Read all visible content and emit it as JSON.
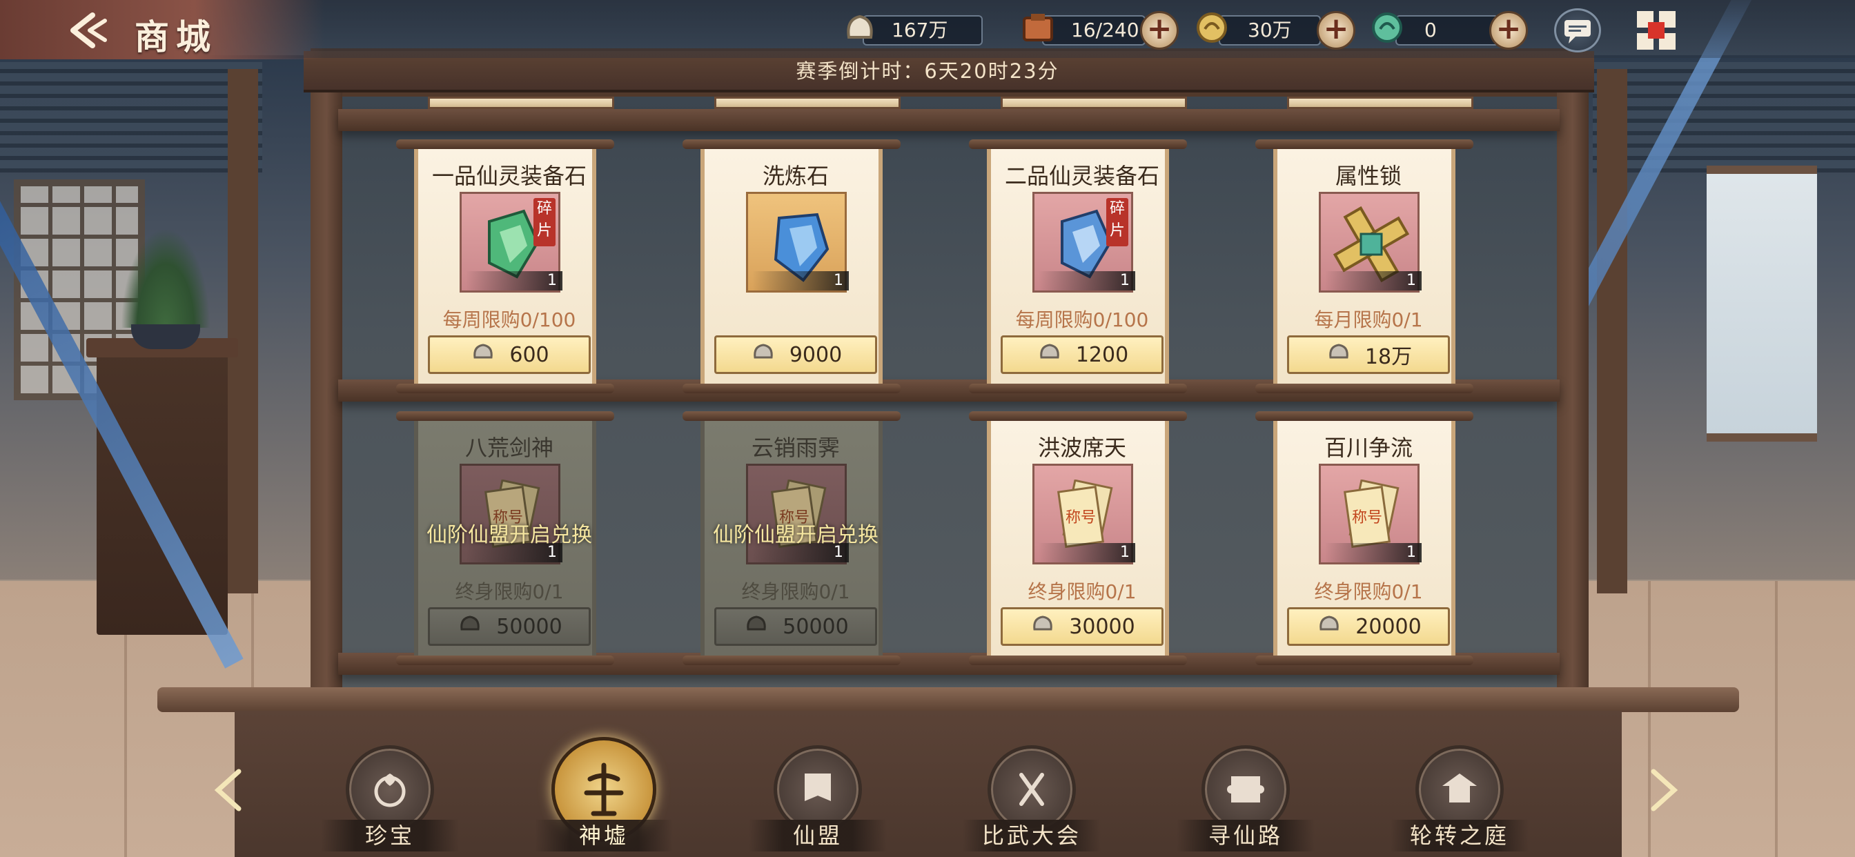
{
  "header": {
    "title": "商城",
    "countdown": "赛季倒计时：6天20时23分"
  },
  "currencies": [
    {
      "name": "silver-coin",
      "value": "167万",
      "color": "#d9b27a"
    },
    {
      "name": "bag",
      "value": "16/240",
      "color": "#c26a3c"
    },
    {
      "name": "gold-dragon",
      "value": "30万",
      "color": "#e2c063"
    },
    {
      "name": "jade-dragon",
      "value": "0",
      "color": "#5fbf9d"
    }
  ],
  "items_row1": [
    {
      "name": "一品仙灵装备石",
      "qty": "1",
      "fragment_tag": "碎片",
      "limit": "每周限购0/100",
      "price": "600",
      "icon": "green-crystal-fragment-icon"
    },
    {
      "name": "洗炼石",
      "qty": "1",
      "fragment_tag": "",
      "limit": "",
      "price": "9000",
      "icon": "blue-stone-icon"
    },
    {
      "name": "二品仙灵装备石",
      "qty": "1",
      "fragment_tag": "碎片",
      "limit": "每周限购0/100",
      "price": "1200",
      "icon": "blue-crystal-fragment-icon"
    },
    {
      "name": "属性锁",
      "qty": "1",
      "fragment_tag": "",
      "limit": "每月限购0/1",
      "price": "18万",
      "icon": "attribute-lock-icon"
    }
  ],
  "items_row2": [
    {
      "name": "八荒剑神",
      "qty": "1",
      "limit": "终身限购0/1",
      "price": "50000",
      "locked": true,
      "lock_text": "仙阶仙盟开启兑换",
      "ticket_text": "称号"
    },
    {
      "name": "云销雨霁",
      "qty": "1",
      "limit": "终身限购0/1",
      "price": "50000",
      "locked": true,
      "lock_text": "仙阶仙盟开启兑换",
      "ticket_text": "称号"
    },
    {
      "name": "洪波席天",
      "qty": "1",
      "limit": "终身限购0/1",
      "price": "30000",
      "locked": false,
      "ticket_text": "称号"
    },
    {
      "name": "百川争流",
      "qty": "1",
      "limit": "终身限购0/1",
      "price": "20000",
      "locked": false,
      "ticket_text": "称号"
    }
  ],
  "tabs": [
    {
      "label": "珍宝",
      "icon": "treasure-icon",
      "active": false
    },
    {
      "label": "神墟",
      "icon": "divine-ruins-icon",
      "active": true
    },
    {
      "label": "仙盟",
      "icon": "alliance-banner-icon",
      "active": false
    },
    {
      "label": "比武大会",
      "icon": "tournament-icon",
      "active": false
    },
    {
      "label": "寻仙路",
      "icon": "scroll-path-icon",
      "active": false
    },
    {
      "label": "轮转之庭",
      "icon": "pavilion-icon",
      "active": false
    }
  ],
  "colors": {
    "price_button": "#f3d98f",
    "limit_text": "#b6744a",
    "lock_text": "#f5e6a0",
    "title_text": "#fbefdc"
  }
}
